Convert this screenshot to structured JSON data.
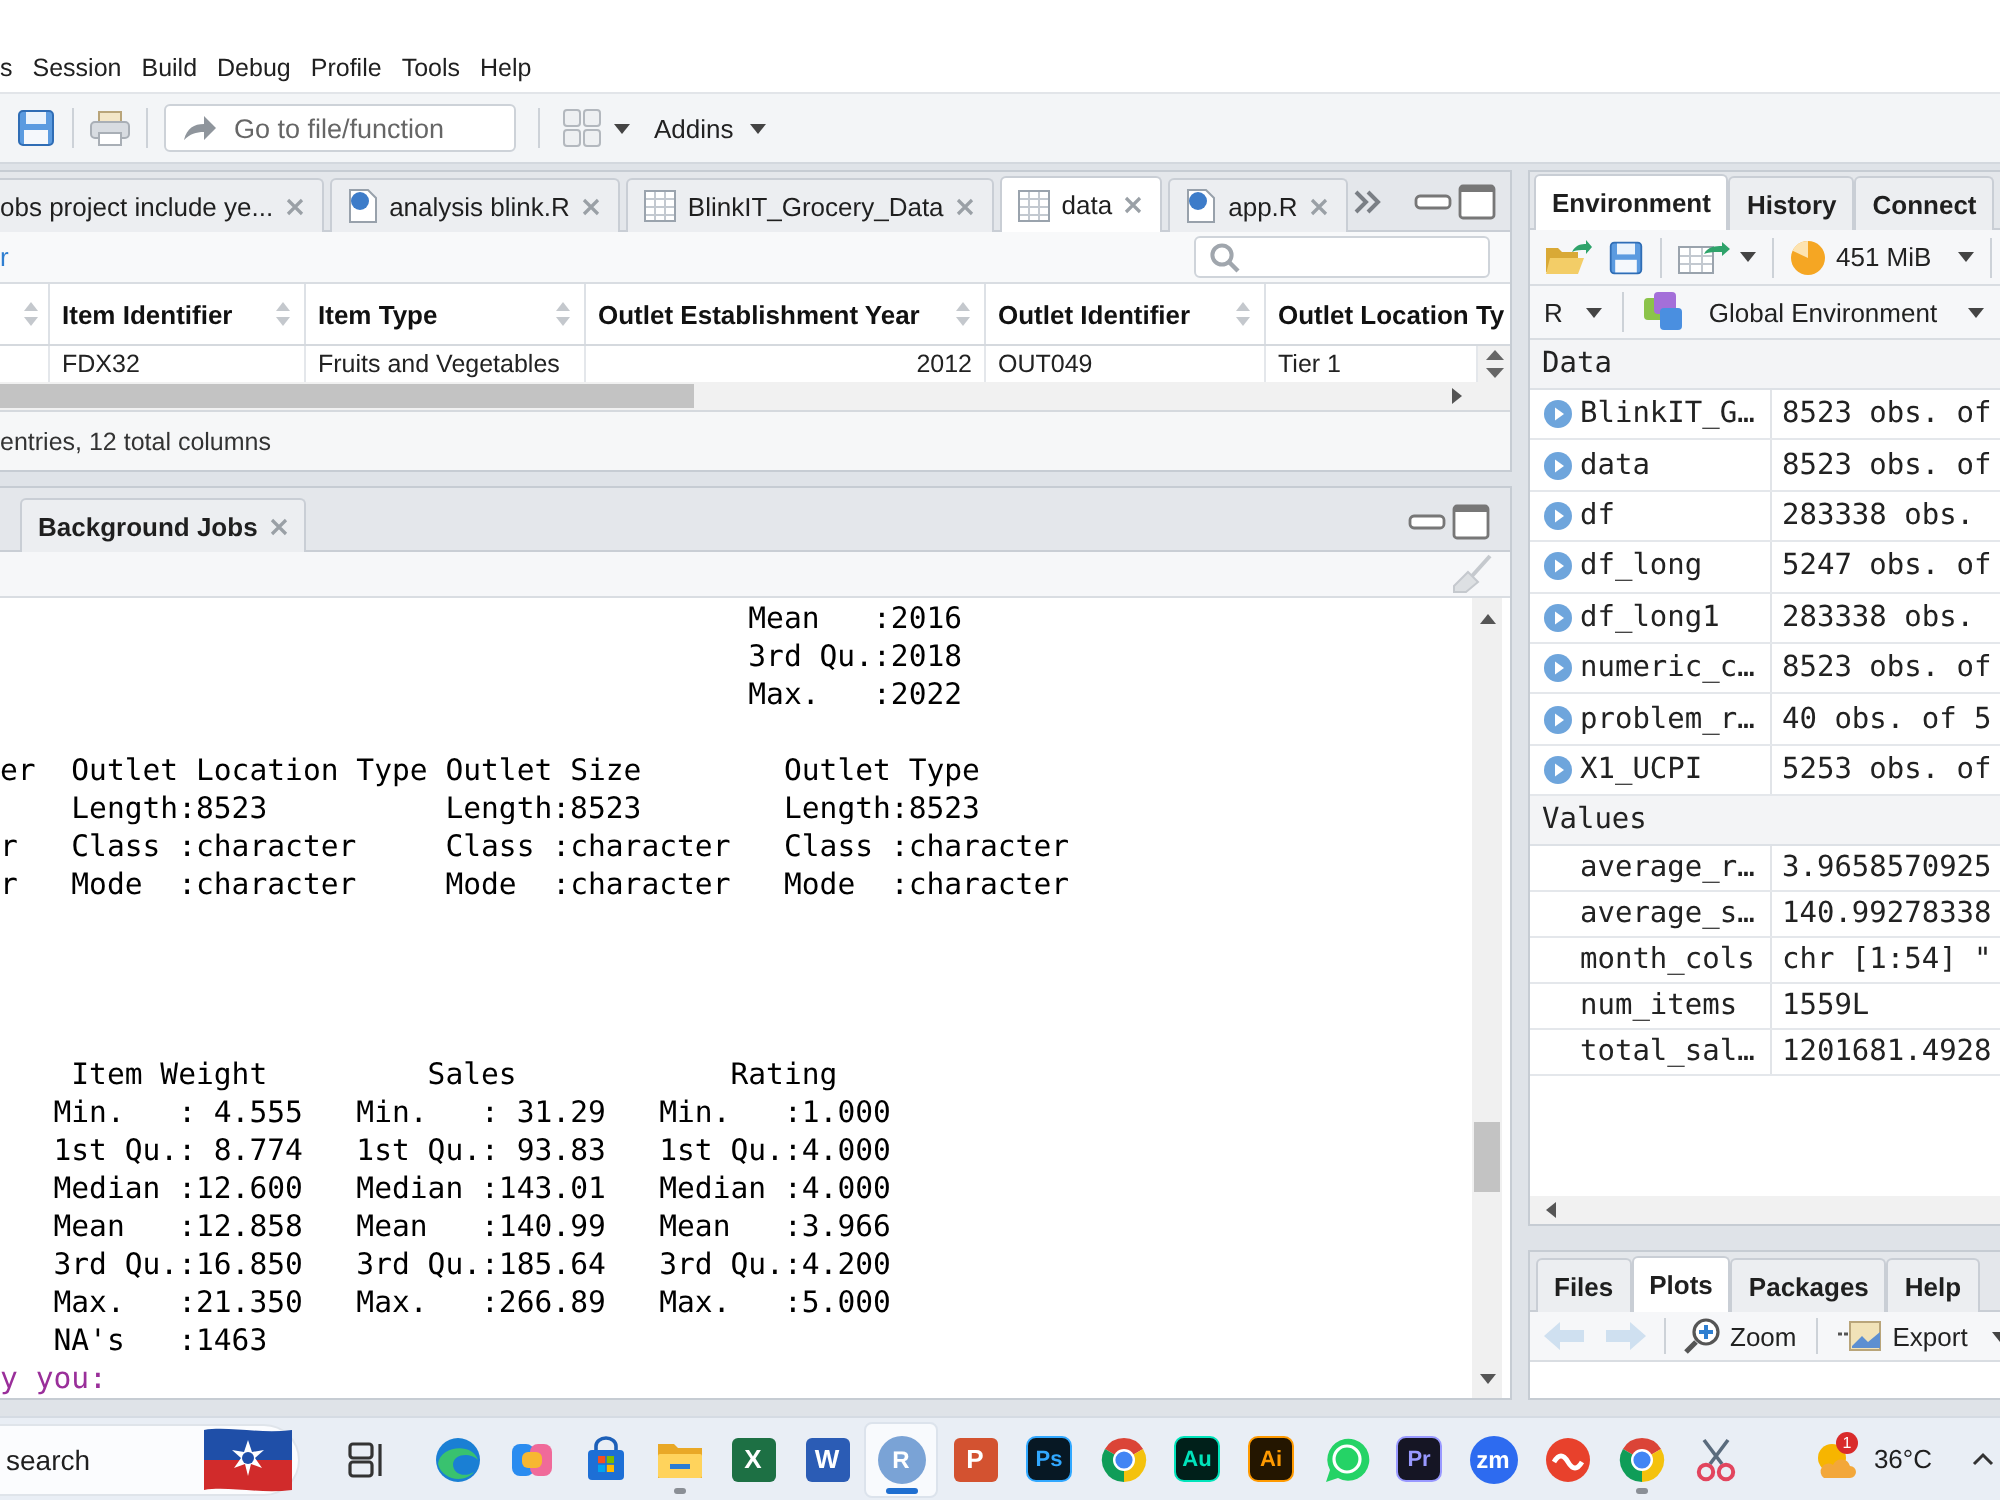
{
  "menu": {
    "items": [
      "s",
      "Session",
      "Build",
      "Debug",
      "Profile",
      "Tools",
      "Help"
    ]
  },
  "toolbar": {
    "goto": {
      "placeholder": "Go to file/function"
    },
    "addins": "Addins"
  },
  "source": {
    "tabs": [
      {
        "kind": "plain",
        "label": "obs project include ye...",
        "selected": false
      },
      {
        "kind": "r-file",
        "label": "analysis blink.R",
        "selected": false
      },
      {
        "kind": "table",
        "label": "BlinkIT_Grocery_Data",
        "selected": false
      },
      {
        "kind": "table",
        "label": "data",
        "selected": true
      },
      {
        "kind": "r-file",
        "label": "app.R",
        "selected": false
      }
    ],
    "filter_link": "r",
    "table": {
      "columns": [
        {
          "label": "Item Identifier",
          "kind": "text"
        },
        {
          "label": "Item Type",
          "kind": "text"
        },
        {
          "label": "Outlet Establishment Year",
          "kind": "number"
        },
        {
          "label": "Outlet Identifier",
          "kind": "text"
        },
        {
          "label": "Outlet Location Ty",
          "kind": "text"
        }
      ],
      "rows": [
        [
          "FDX32",
          "Fruits and Vegetables",
          "2012",
          "OUT049",
          "Tier 1"
        ]
      ]
    },
    "status": "entries, 12 total columns"
  },
  "console": {
    "tabs": [
      {
        "label": "Background Jobs",
        "selected": false
      }
    ],
    "blocks": [
      {
        "kind": "output",
        "lines": [
          "                                          Mean   :2016",
          "                                          3rd Qu.:2018",
          "                                          Max.   :2022"
        ]
      },
      {
        "kind": "output",
        "lines": [
          "er  Outlet Location Type Outlet Size        Outlet Type",
          "    Length:8523          Length:8523        Length:8523",
          "r   Class :character     Class :character   Class :character",
          "r   Mode  :character     Mode  :character   Mode  :character"
        ]
      },
      {
        "kind": "output",
        "lines": [
          "    Item Weight         Sales            Rating",
          "   Min.   : 4.555   Min.   : 31.29   Min.   :1.000",
          "   1st Qu.: 8.774   1st Qu.: 93.83   1st Qu.:4.000",
          "   Median :12.600   Median :143.01   Median :4.000",
          "   Mean   :12.858   Mean   :140.99   Mean   :3.966",
          "   3rd Qu.:16.850   3rd Qu.:185.64   3rd Qu.:4.200",
          "   Max.   :21.350   Max.   :266.89   Max.   :5.000",
          "   NA's   :1463"
        ]
      },
      {
        "kind": "message",
        "lines": [
          "y you:"
        ]
      }
    ]
  },
  "environment": {
    "tabs": [
      {
        "label": "Environment",
        "selected": true
      },
      {
        "label": "History",
        "selected": false
      },
      {
        "label": "Connect",
        "selected": false
      }
    ],
    "memory": "451 MiB",
    "language": "R",
    "scope": "Global Environment",
    "sections": [
      {
        "title": "Data",
        "rows": [
          {
            "name": "BlinkIT_G…",
            "value": "8523 obs. of",
            "expandable": true
          },
          {
            "name": "data",
            "value": "8523 obs. of",
            "expandable": true
          },
          {
            "name": "df",
            "value": "283338 obs.",
            "expandable": true
          },
          {
            "name": "df_long",
            "value": "5247 obs. of",
            "expandable": true
          },
          {
            "name": "df_long1",
            "value": "283338 obs.",
            "expandable": true
          },
          {
            "name": "numeric_c…",
            "value": "8523 obs. of",
            "expandable": true
          },
          {
            "name": "problem_r…",
            "value": "40 obs. of 5",
            "expandable": true
          },
          {
            "name": "X1_UCPI",
            "value": "5253 obs. of",
            "expandable": true
          }
        ]
      },
      {
        "title": "Values",
        "rows": [
          {
            "name": "average_r…",
            "value": "3.9658570925",
            "expandable": false
          },
          {
            "name": "average_s…",
            "value": "140.99278338",
            "expandable": false
          },
          {
            "name": "month_cols",
            "value": "chr [1:54] \"",
            "expandable": false
          },
          {
            "name": "num_items",
            "value": "1559L",
            "expandable": false
          },
          {
            "name": "total_sal…",
            "value": "1201681.4928",
            "expandable": false
          }
        ]
      }
    ]
  },
  "files": {
    "tabs": [
      {
        "label": "Files",
        "selected": false
      },
      {
        "label": "Plots",
        "selected": true
      },
      {
        "label": "Packages",
        "selected": false
      },
      {
        "label": "Help",
        "selected": false
      }
    ],
    "back": {
      "disabled": true
    },
    "forward": {
      "disabled": true
    },
    "zoom": "Zoom",
    "export": "Export"
  },
  "taskbar": {
    "search": {
      "placeholder": "search"
    },
    "apps": [
      {
        "kind": "taskview",
        "selected": false,
        "running": false
      },
      {
        "kind": "edge",
        "selected": false,
        "running": false
      },
      {
        "kind": "copilot",
        "selected": false,
        "running": false
      },
      {
        "kind": "store",
        "selected": false,
        "running": false
      },
      {
        "kind": "folder",
        "selected": false,
        "running": true
      },
      {
        "kind": "office",
        "text": "X",
        "color": "#1d7044",
        "selected": false,
        "running": false
      },
      {
        "kind": "office",
        "text": "W",
        "color": "#2b5cb5",
        "selected": false,
        "running": false
      },
      {
        "kind": "round",
        "text": "R",
        "color": "#7aa3d6",
        "selected": true,
        "running": true
      },
      {
        "kind": "office",
        "text": "P",
        "color": "#d35230",
        "selected": false,
        "running": false
      },
      {
        "kind": "adobe",
        "text": "Ps",
        "color": "#31a8ff",
        "selected": false,
        "running": false
      },
      {
        "kind": "chrome",
        "selected": false,
        "running": false
      },
      {
        "kind": "adobe",
        "text": "Au",
        "color": "#00e4bb",
        "selected": false,
        "running": false
      },
      {
        "kind": "adobe",
        "text": "Ai",
        "color": "#ff9a00",
        "selected": false,
        "running": false
      },
      {
        "kind": "whatsapp",
        "selected": false,
        "running": false
      },
      {
        "kind": "adobe",
        "text": "Pr",
        "color": "#9999ff",
        "selected": false,
        "running": false
      },
      {
        "kind": "round",
        "text": "zm",
        "color": "#2d6bf0",
        "selected": false,
        "running": false
      },
      {
        "kind": "wps",
        "selected": false,
        "running": false
      },
      {
        "kind": "chrome",
        "selected": false,
        "running": true
      },
      {
        "kind": "snip",
        "selected": false,
        "running": false
      }
    ],
    "weather": {
      "badge": "1",
      "temperature": "36°C"
    }
  }
}
